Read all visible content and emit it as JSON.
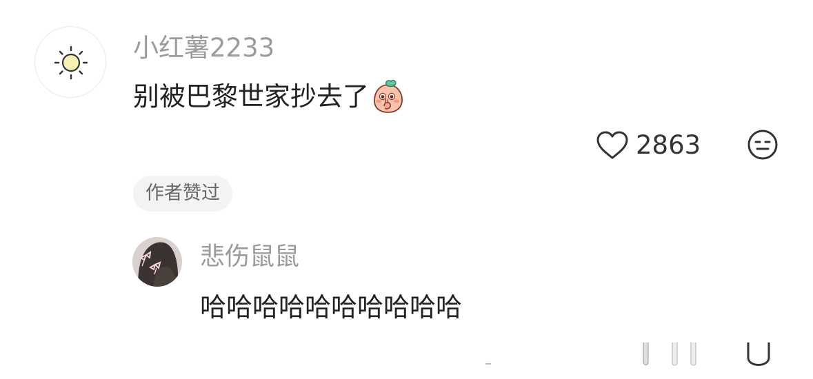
{
  "comment": {
    "username": "小红薯2233",
    "text": "别被巴黎世家抄去了",
    "avatar_icon": "sun-icon",
    "emoji_icon": "shy-peach-emoji-icon",
    "like_icon": "heart-icon",
    "like_count": "2863",
    "dislike_icon": "meh-face-icon",
    "author_badge": "作者赞过"
  },
  "reply": {
    "username": "悲伤鼠鼠",
    "text": "哈哈哈哈哈哈哈哈哈哈",
    "avatar_icon": "profile-photo"
  },
  "colors": {
    "username": "#9b9b9b",
    "text": "#222222",
    "badge_bg": "#f3f3f3",
    "sun_fill": "#f8efb3"
  }
}
